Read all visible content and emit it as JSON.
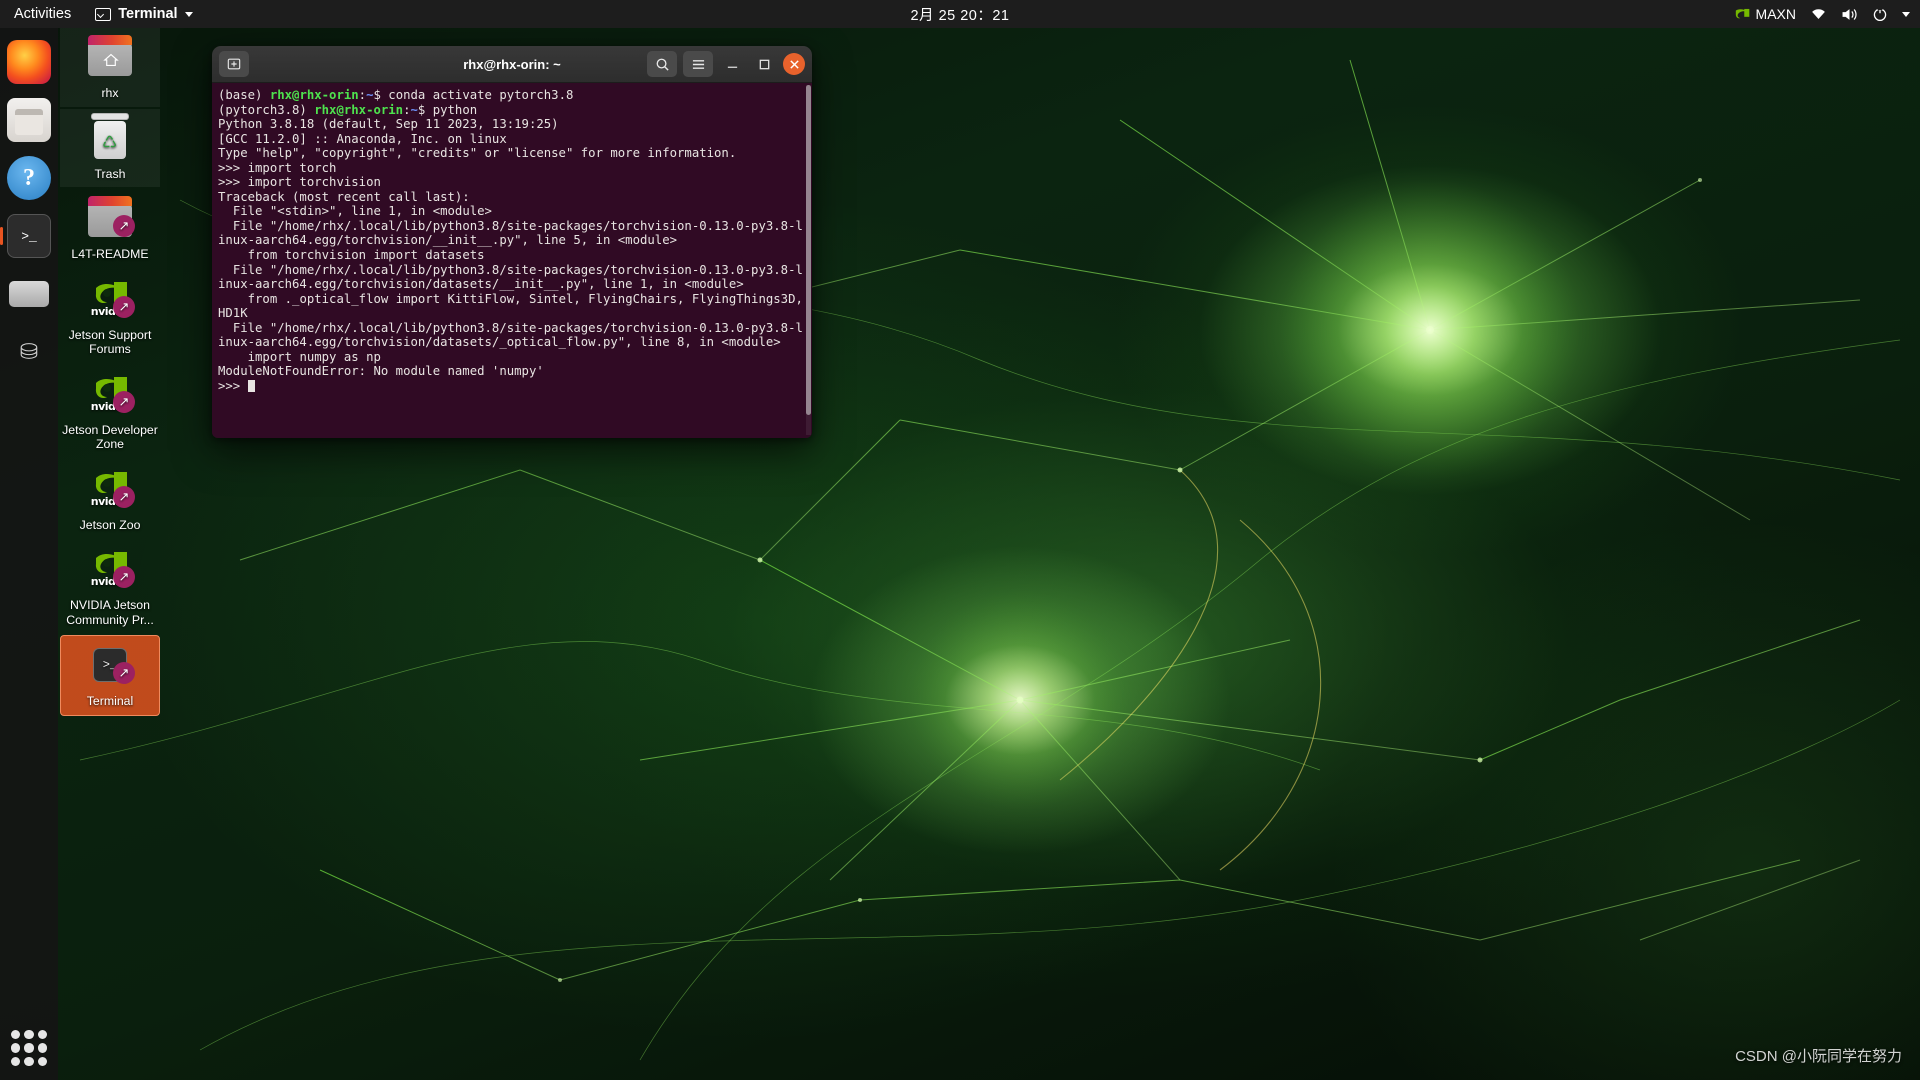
{
  "topbar": {
    "activities": "Activities",
    "app_name": "Terminal",
    "app_icon": "terminal-icon",
    "clock": "2月 25  20：21",
    "power_mode": "MAXN",
    "icons": [
      "nvidia-logo-icon",
      "wifi-icon",
      "volume-icon",
      "power-icon",
      "chevron-down-icon"
    ]
  },
  "dock": {
    "items": [
      {
        "name": "firefox",
        "label": "Firefox"
      },
      {
        "name": "files",
        "label": "Files"
      },
      {
        "name": "help",
        "label": "Help",
        "glyph": "?"
      },
      {
        "name": "terminal",
        "label": "Terminal",
        "glyph": ">_",
        "active": true
      },
      {
        "name": "disk",
        "label": "Disks"
      },
      {
        "name": "usb",
        "label": "USB Drive",
        "glyph": "⛁"
      }
    ],
    "show_apps": "Show Applications"
  },
  "desktop_icons": [
    {
      "label": "rhx",
      "type": "home-folder",
      "selected": false
    },
    {
      "label": "Trash",
      "type": "trash",
      "selected": false
    },
    {
      "label": "L4T-README",
      "type": "folder-link",
      "selected": false
    },
    {
      "label": "Jetson Support Forums",
      "type": "nvidia-link",
      "selected": false
    },
    {
      "label": "Jetson Developer Zone",
      "type": "nvidia-link",
      "selected": false
    },
    {
      "label": "Jetson Zoo",
      "type": "nvidia-link",
      "selected": false
    },
    {
      "label": "NVIDIA Jetson Community Pr...",
      "type": "nvidia-link",
      "selected": false
    },
    {
      "label": "Terminal",
      "type": "terminal-link",
      "selected": true
    }
  ],
  "terminal": {
    "title": "rhx@rhx-orin: ~",
    "new_tab_label": "+",
    "search_label": "Search",
    "menu_label": "Menu",
    "minimize_label": "—",
    "maximize_label": "□",
    "close_label": "×",
    "lines": [
      {
        "parts": [
          {
            "t": "(base) ",
            "c": "plain"
          },
          {
            "t": "rhx@rhx-orin",
            "c": "g"
          },
          {
            "t": ":",
            "c": "plain"
          },
          {
            "t": "~",
            "c": "b"
          },
          {
            "t": "$ conda activate pytorch3.8",
            "c": "plain"
          }
        ]
      },
      {
        "parts": [
          {
            "t": "(pytorch3.8) ",
            "c": "plain"
          },
          {
            "t": "rhx@rhx-orin",
            "c": "g"
          },
          {
            "t": ":",
            "c": "plain"
          },
          {
            "t": "~",
            "c": "b"
          },
          {
            "t": "$ python",
            "c": "plain"
          }
        ]
      },
      {
        "parts": [
          {
            "t": "Python 3.8.18 (default, Sep 11 2023, 13:19:25)",
            "c": "plain"
          }
        ]
      },
      {
        "parts": [
          {
            "t": "[GCC 11.2.0] :: Anaconda, Inc. on linux",
            "c": "plain"
          }
        ]
      },
      {
        "parts": [
          {
            "t": "Type \"help\", \"copyright\", \"credits\" or \"license\" for more information.",
            "c": "plain"
          }
        ]
      },
      {
        "parts": [
          {
            "t": ">>> import torch",
            "c": "plain"
          }
        ]
      },
      {
        "parts": [
          {
            "t": ">>> import torchvision",
            "c": "plain"
          }
        ]
      },
      {
        "parts": [
          {
            "t": "Traceback (most recent call last):",
            "c": "plain"
          }
        ]
      },
      {
        "parts": [
          {
            "t": "  File \"<stdin>\", line 1, in <module>",
            "c": "plain"
          }
        ]
      },
      {
        "parts": [
          {
            "t": "  File \"/home/rhx/.local/lib/python3.8/site-packages/torchvision-0.13.0-py3.8-linux-aarch64.egg/torchvision/__init__.py\", line 5, in <module>",
            "c": "plain"
          }
        ]
      },
      {
        "parts": [
          {
            "t": "    from torchvision import datasets",
            "c": "plain"
          }
        ]
      },
      {
        "parts": [
          {
            "t": "  File \"/home/rhx/.local/lib/python3.8/site-packages/torchvision-0.13.0-py3.8-linux-aarch64.egg/torchvision/datasets/__init__.py\", line 1, in <module>",
            "c": "plain"
          }
        ]
      },
      {
        "parts": [
          {
            "t": "    from ._optical_flow import KittiFlow, Sintel, FlyingChairs, FlyingThings3D, HD1K",
            "c": "plain"
          }
        ]
      },
      {
        "parts": [
          {
            "t": "  File \"/home/rhx/.local/lib/python3.8/site-packages/torchvision-0.13.0-py3.8-linux-aarch64.egg/torchvision/datasets/_optical_flow.py\", line 8, in <module>",
            "c": "plain"
          }
        ]
      },
      {
        "parts": [
          {
            "t": "    import numpy as np",
            "c": "plain"
          }
        ]
      },
      {
        "parts": [
          {
            "t": "ModuleNotFoundError: No module named 'numpy'",
            "c": "plain"
          }
        ]
      },
      {
        "parts": [
          {
            "t": ">>> ",
            "c": "plain"
          }
        ],
        "cursor": true
      }
    ]
  },
  "watermark": "CSDN @小阮同学在努力",
  "colors": {
    "terminal_bg": "#300a24",
    "prompt_green": "#4ee24e",
    "prompt_blue": "#6d8ff5",
    "close_orange": "#e8622c",
    "selection_orange": "#e95420",
    "nvidia_green": "#76b900",
    "link_badge": "#9c2161"
  }
}
